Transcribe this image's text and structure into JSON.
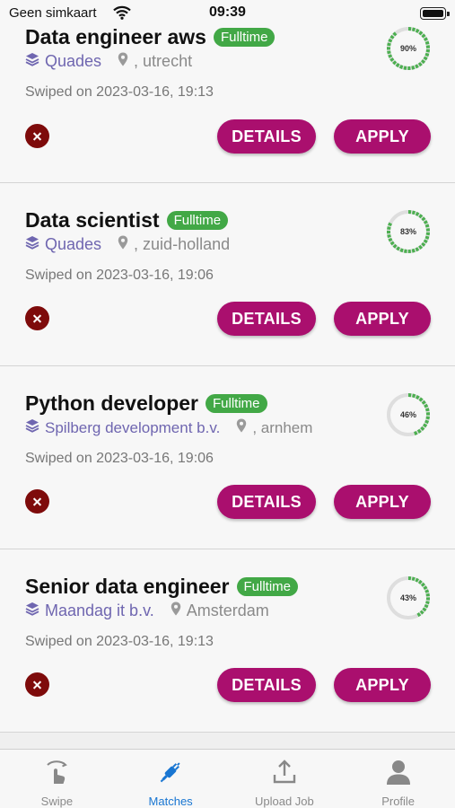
{
  "status_bar": {
    "carrier": "Geen simkaart",
    "time": "09:39"
  },
  "cards": [
    {
      "title": "Data engineer aws",
      "type": "Fulltime",
      "company": "Quades",
      "location": ", utrecht",
      "swiped": "Swiped on 2023-03-16, 19:13",
      "score": "90%",
      "score_value": 0.9,
      "details_label": "DETAILS",
      "apply_label": "APPLY"
    },
    {
      "title": "Data scientist",
      "type": "Fulltime",
      "company": "Quades",
      "location": ", zuid-holland",
      "swiped": "Swiped on 2023-03-16, 19:06",
      "score": "83%",
      "score_value": 0.83,
      "details_label": "DETAILS",
      "apply_label": "APPLY"
    },
    {
      "title": "Python developer",
      "type": "Fulltime",
      "company": "Spilberg development b.v.",
      "location": ", arnhem",
      "swiped": "Swiped on 2023-03-16, 19:06",
      "score": "46%",
      "score_value": 0.46,
      "details_label": "DETAILS",
      "apply_label": "APPLY"
    },
    {
      "title": "Senior data engineer",
      "type": "Fulltime",
      "company": "Maandag it b.v.",
      "location": "Amsterdam",
      "swiped": "Swiped on 2023-03-16, 19:13",
      "score": "43%",
      "score_value": 0.43,
      "details_label": "DETAILS",
      "apply_label": "APPLY"
    }
  ],
  "tabs": [
    {
      "label": "Swipe",
      "icon": "swipe-icon"
    },
    {
      "label": "Matches",
      "icon": "plug-icon"
    },
    {
      "label": "Upload Job",
      "icon": "upload-icon"
    },
    {
      "label": "Profile",
      "icon": "person-icon"
    }
  ],
  "active_tab": "Matches",
  "colors": {
    "accent": "#aa0f6e",
    "badge": "#42a846",
    "reject": "#7e0b0b",
    "active_tab": "#1976d2",
    "company": "#6f66b0",
    "score_ring": "#4caf50"
  }
}
